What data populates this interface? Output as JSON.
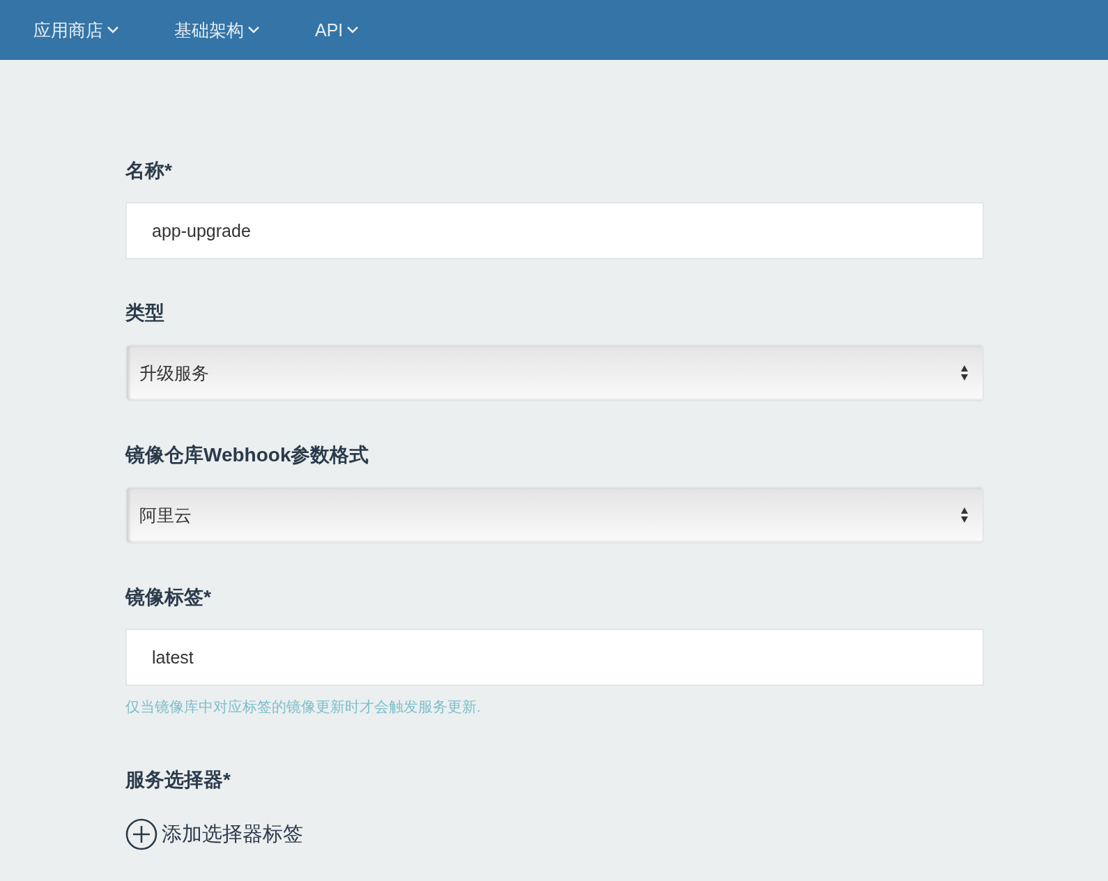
{
  "nav": {
    "items": [
      {
        "label": "应用商店"
      },
      {
        "label": "基础架构"
      },
      {
        "label": "API"
      }
    ]
  },
  "form": {
    "fields": [
      {
        "kind": "text",
        "label": "名称*",
        "value": "app-upgrade"
      },
      {
        "kind": "select",
        "label": "类型",
        "value": "升级服务"
      },
      {
        "kind": "select",
        "label": "镜像仓库Webhook参数格式",
        "value": "阿里云"
      },
      {
        "kind": "text",
        "label": "镜像标签*",
        "value": "latest",
        "hint": "仅当镜像库中对应标签的镜像更新时才会触发服务更新."
      },
      {
        "kind": "add",
        "label": "服务选择器*",
        "value": "添加选择器标签"
      }
    ]
  }
}
